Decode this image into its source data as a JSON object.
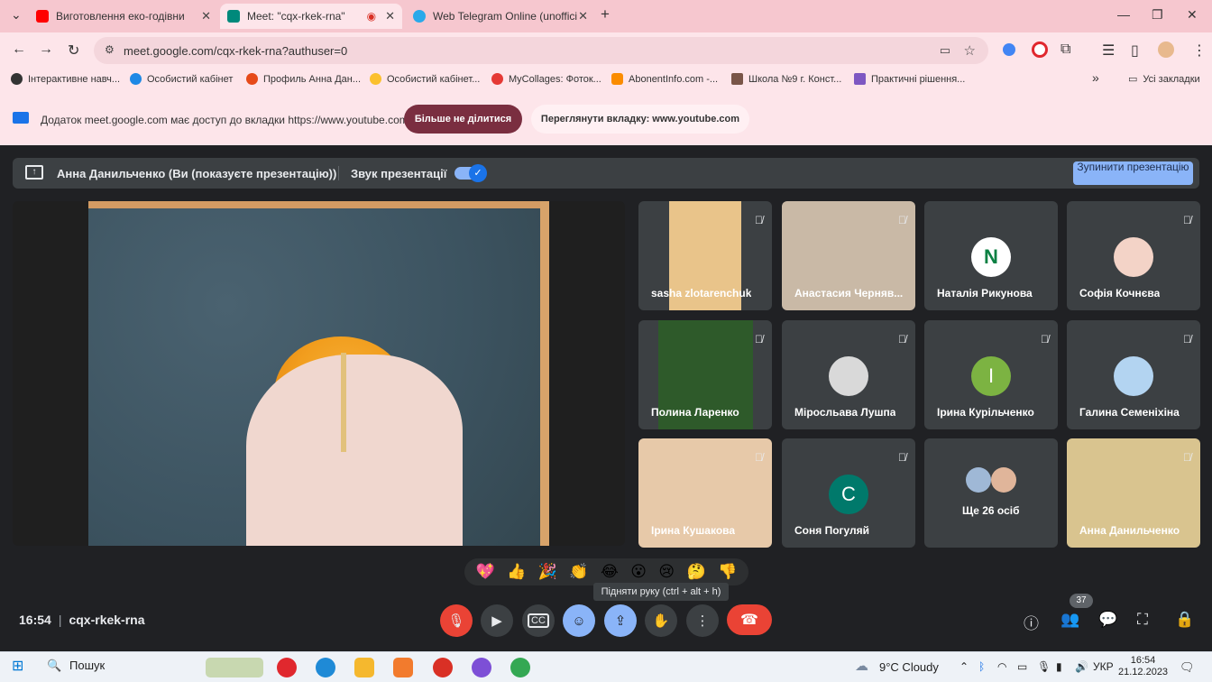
{
  "browser": {
    "tabs": [
      {
        "label": "Виготовлення еко-годівни",
        "color": "#ff0000"
      },
      {
        "label": "Meet: \"cqx-rkek-rna\"",
        "color": "#00897b"
      },
      {
        "label": "Web Telegram Online (unoffici",
        "color": "#29a9ea"
      }
    ],
    "new_tab": "+",
    "url": "meet.google.com/cqx-rkek-rna?authuser=0",
    "bookmarks": [
      {
        "label": "Інтерактивне навч...",
        "color": "#333333"
      },
      {
        "label": "Особистий кабінет",
        "color": "#1e88e5"
      },
      {
        "label": "Профиль Анна Дан...",
        "color": "#e64a19"
      },
      {
        "label": "Особистий кабінет...",
        "color": "#fbc02d"
      },
      {
        "label": "MyCollages: Фоток...",
        "color": "#e53935"
      },
      {
        "label": "AbonentInfo.com -...",
        "color": "#fb8c00"
      },
      {
        "label": "Школа №9 г. Конст...",
        "color": "#795548"
      },
      {
        "label": "Практичні рішення...",
        "color": "#7e57c2"
      }
    ],
    "bookmarks_more": "»",
    "all_bookmarks": "Усі закладки"
  },
  "infobar": {
    "text": "Додаток meet.google.com має доступ до вкладки https://www.youtube.com",
    "stop_sharing": "Більше не ділитися",
    "view_tab": "Переглянути вкладку: www.youtube.com"
  },
  "meet": {
    "presenting_text": "Анна Данильченко (Ви (показуєте презентацію))",
    "audio_label": "Звук презентації",
    "stop_label": "Зупинити презентацію",
    "participants": [
      {
        "name": "sasha zlotarenchuk",
        "type": "video",
        "color": "#e9c48a"
      },
      {
        "name": "Анастасия Черняв...",
        "type": "video",
        "color": "#c9b9a6"
      },
      {
        "name": "Наталія Рикунова",
        "type": "avatar",
        "letter": "N",
        "color": "#ffffff"
      },
      {
        "name": "Софія Кочнєва",
        "type": "avatar",
        "letter": "",
        "color": "#f3d3c7"
      },
      {
        "name": "Полина Ларенко",
        "type": "video",
        "color": "#2e5a2a"
      },
      {
        "name": "Міросльава Лушпа",
        "type": "avatar",
        "letter": "",
        "color": "#d9d9d9"
      },
      {
        "name": "Ірина Курільченко",
        "type": "avatar",
        "letter": "I",
        "color": "#7cb342"
      },
      {
        "name": "Галина Семеніхіна",
        "type": "avatar",
        "letter": "",
        "color": "#b3d4f1"
      },
      {
        "name": "Ірина Кушакова",
        "type": "video",
        "color": "#e7c9a9"
      },
      {
        "name": "Соня Погуляй",
        "type": "avatar",
        "letter": "C",
        "color": "#00796b"
      },
      {
        "name": "Ще 26 осіб",
        "type": "more",
        "color": "#9fb8d6"
      },
      {
        "name": "Анна Данильченко",
        "type": "video",
        "color": "#d9c48f"
      }
    ],
    "reactions": [
      "💖",
      "👍",
      "🎉",
      "👏",
      "😂",
      "😮",
      "😢",
      "🤔",
      "👎"
    ],
    "tooltip": "Підняти руку (ctrl + alt + h)",
    "time": "16:54",
    "meeting_code": "cqx-rkek-rna",
    "people_count": "37"
  },
  "taskbar": {
    "search": "Пошук",
    "weather": "9°C  Cloudy",
    "lang": "УКР",
    "time": "16:54",
    "date": "21.12.2023",
    "icons": [
      {
        "name": "opera",
        "color": "#e0282e"
      },
      {
        "name": "edge",
        "color": "#1f8ad6"
      },
      {
        "name": "files",
        "color": "#f5b82e"
      },
      {
        "name": "app-orange",
        "color": "#f27b2d"
      },
      {
        "name": "chrome-1",
        "color": "#d93025"
      },
      {
        "name": "viber",
        "color": "#7d4fd6"
      },
      {
        "name": "chrome-2",
        "color": "#34a853"
      }
    ]
  }
}
